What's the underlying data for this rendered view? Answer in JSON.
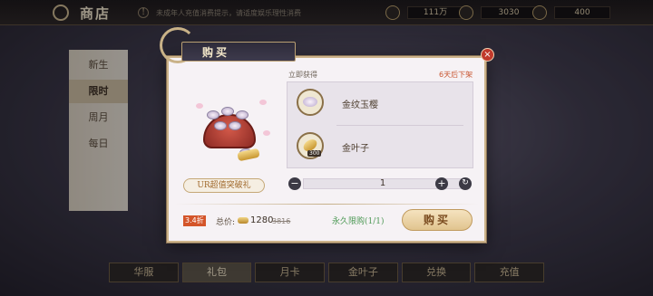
{
  "topbar": {
    "title": "商店",
    "notice": "未成年人充值消费提示，请适度娱乐理性消费",
    "currencies": [
      {
        "icon": "silver-coin-icon",
        "value": "111万"
      },
      {
        "icon": "gold-leaf-icon",
        "value": "3030"
      },
      {
        "icon": "gold-ingot-icon",
        "value": "400"
      }
    ]
  },
  "leftnav": {
    "items": [
      "新生",
      "限时",
      "周月",
      "每日"
    ],
    "active_index": 1
  },
  "bottom_tabs": {
    "items": [
      "华服",
      "礼包",
      "月卡",
      "金叶子",
      "兑换",
      "充值"
    ],
    "active_index": 1
  },
  "dialog": {
    "title": "购买",
    "item_name": "UR超值突破礼",
    "immediate_label": "立即获得",
    "expire_label": "6天后下架",
    "rewards": [
      {
        "name": "金纹玉樱",
        "qty": "",
        "icon": "cherry-cake-icon"
      },
      {
        "name": "金叶子",
        "qty": "300",
        "icon": "gold-leaf-icon"
      }
    ],
    "quantity": "1",
    "discount": "3.4折",
    "total_label": "总价:",
    "total_price": "1280",
    "original_price": "3816",
    "limit_text": "永久限购(1/1)",
    "buy_label": "购买",
    "close_label": "×",
    "minus_label": "−",
    "plus_label": "+",
    "reset_label": "↻"
  }
}
